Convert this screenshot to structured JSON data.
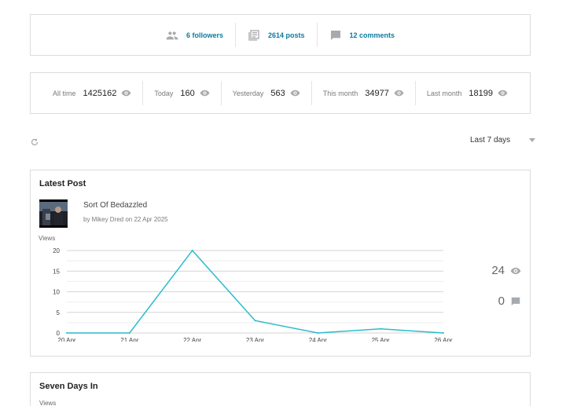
{
  "stats": {
    "followers": "6 followers",
    "posts": "2614 posts",
    "comments": "12 comments"
  },
  "views_summary": [
    {
      "label": "All time",
      "value": "1425162"
    },
    {
      "label": "Today",
      "value": "160"
    },
    {
      "label": "Yesterday",
      "value": "563"
    },
    {
      "label": "This month",
      "value": "34977"
    },
    {
      "label": "Last month",
      "value": "18199"
    }
  ],
  "toolbar": {
    "period": "Last 7 days"
  },
  "latest_post": {
    "section_title": "Latest Post",
    "title": "Sort Of Bedazzled",
    "byline": "by Mikey Dred on 22 Apr 2025",
    "views": "24",
    "comments": "0"
  },
  "seven_days": {
    "section_title": "Seven Days In",
    "ylabel": "Views"
  },
  "colors": {
    "accent": "#0a7c9d",
    "line": "#2bbccc",
    "icon": "#a7aaad"
  },
  "chart_data": {
    "type": "line",
    "title": "",
    "xlabel": "",
    "ylabel": "Views",
    "categories": [
      "20 Apr",
      "21 Apr",
      "22 Apr",
      "23 Apr",
      "24 Apr",
      "25 Apr",
      "26 Apr"
    ],
    "values": [
      0,
      0,
      20,
      3,
      0,
      1,
      0
    ],
    "y_ticks": [
      "0",
      "5",
      "10",
      "15",
      "20"
    ],
    "ylim": [
      0,
      20
    ],
    "grid": true
  }
}
